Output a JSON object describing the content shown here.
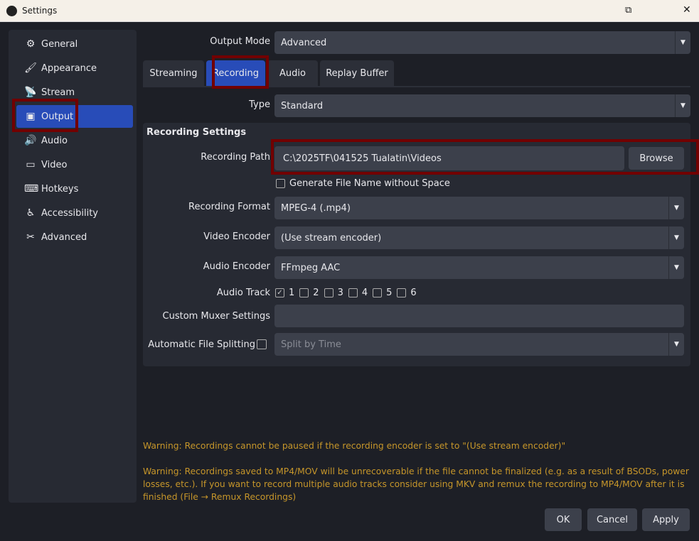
{
  "window": {
    "title": "Settings",
    "close": "✕",
    "restore": "⧉"
  },
  "sidebar": {
    "items": [
      {
        "label": "General",
        "icon": "⚙",
        "name": "gear-icon"
      },
      {
        "label": "Appearance",
        "icon": "🖌",
        "name": "appearance-icon"
      },
      {
        "label": "Stream",
        "icon": "📡",
        "name": "antenna-icon"
      },
      {
        "label": "Output",
        "icon": "▣",
        "name": "output-icon"
      },
      {
        "label": "Audio",
        "icon": "🔊",
        "name": "speaker-icon"
      },
      {
        "label": "Video",
        "icon": "▭",
        "name": "monitor-icon"
      },
      {
        "label": "Hotkeys",
        "icon": "⌨",
        "name": "keyboard-icon"
      },
      {
        "label": "Accessibility",
        "icon": "♿",
        "name": "accessibility-icon"
      },
      {
        "label": "Advanced",
        "icon": "✂",
        "name": "tools-icon"
      }
    ]
  },
  "output_mode": {
    "label": "Output Mode",
    "value": "Advanced"
  },
  "tabs": [
    "Streaming",
    "Recording",
    "Audio",
    "Replay Buffer"
  ],
  "type": {
    "label": "Type",
    "value": "Standard"
  },
  "recording": {
    "section_title": "Recording Settings",
    "path_label": "Recording Path",
    "path_value": "C:\\2025TF\\041525 Tualatin\\Videos",
    "browse": "Browse",
    "no_space_label": "Generate File Name without Space",
    "format_label": "Recording Format",
    "format_value": "MPEG-4 (.mp4)",
    "video_encoder_label": "Video Encoder",
    "video_encoder_value": "(Use stream encoder)",
    "audio_encoder_label": "Audio Encoder",
    "audio_encoder_value": "FFmpeg AAC",
    "audio_track_label": "Audio Track",
    "tracks": [
      "1",
      "2",
      "3",
      "4",
      "5",
      "6"
    ],
    "tracks_checked": [
      true,
      false,
      false,
      false,
      false,
      false
    ],
    "muxer_label": "Custom Muxer Settings",
    "muxer_value": "",
    "split_label": "Automatic File Splitting",
    "split_value": "Split by Time"
  },
  "warnings": [
    "Warning: Recordings cannot be paused if the recording encoder is set to \"(Use stream encoder)\"",
    "Warning: Recordings saved to MP4/MOV will be unrecoverable if the file cannot be finalized (e.g. as a result of BSODs, power losses, etc.). If you want to record multiple audio tracks consider using MKV and remux the recording to MP4/MOV after it is finished (File → Remux Recordings)"
  ],
  "buttons": {
    "ok": "OK",
    "cancel": "Cancel",
    "apply": "Apply"
  }
}
